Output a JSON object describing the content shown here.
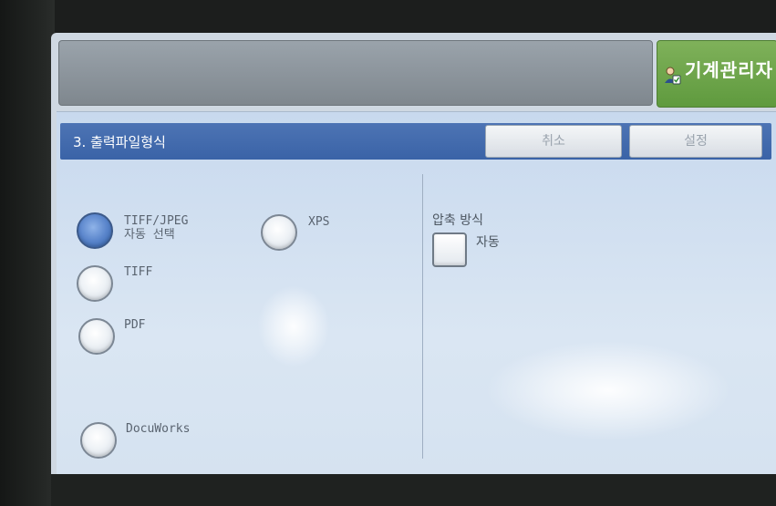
{
  "header": {
    "status_text": "",
    "admin_label": "기계관리자"
  },
  "dialog": {
    "title": "3. 출력파일형식",
    "cancel_label": "취소",
    "set_label": "설정"
  },
  "format_options": [
    {
      "label_line1": "TIFF/JPEG",
      "label_line2": "자동 선택",
      "selected": true
    },
    {
      "label_line1": "TIFF",
      "label_line2": "",
      "selected": false
    },
    {
      "label_line1": "PDF",
      "label_line2": "",
      "selected": false
    },
    {
      "label_line1": "DocuWorks",
      "label_line2": "",
      "selected": false
    },
    {
      "label_line1": "XPS",
      "label_line2": "",
      "selected": false
    }
  ],
  "compression": {
    "label": "압축 방식",
    "auto_label": "자동",
    "checked": false
  },
  "colors": {
    "title_bar": "#3a63a7",
    "admin_button": "#5f9a3e",
    "selected_radio": "#2f5ea7"
  }
}
